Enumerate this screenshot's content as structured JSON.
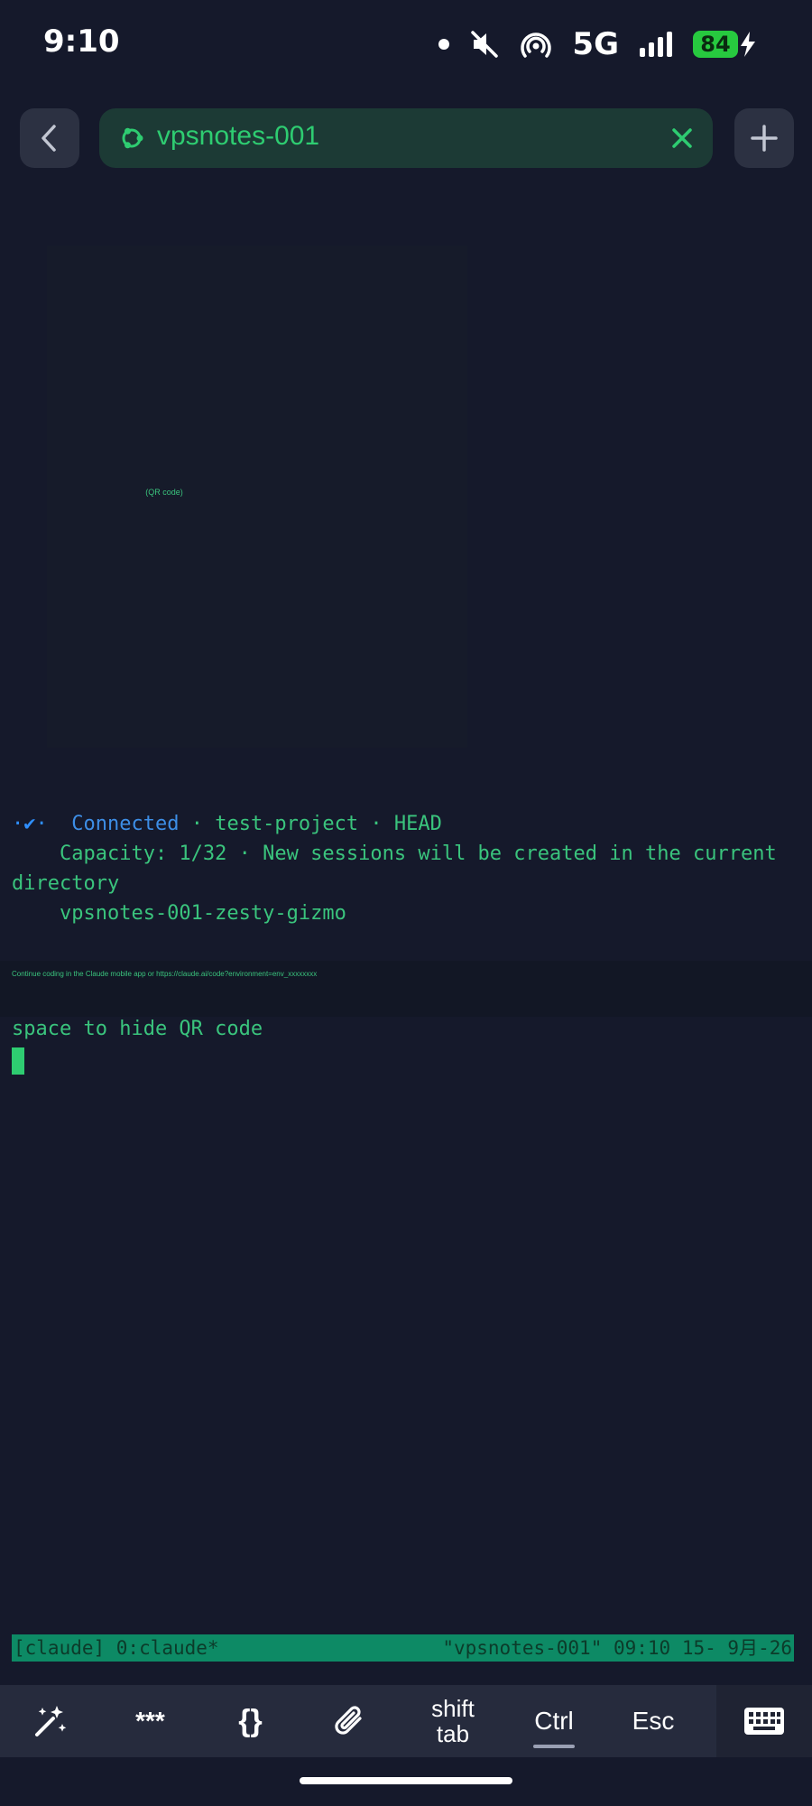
{
  "status_bar": {
    "time": "9:10",
    "network": "5G",
    "battery": "84",
    "icons": [
      "dot-icon",
      "mute-icon",
      "hotspot-icon",
      "signal-icon",
      "battery-icon",
      "charging-icon"
    ]
  },
  "nav": {
    "back_icon": "chevron-left-icon",
    "session_icon": "ubuntu-icon",
    "session_name": "vpsnotes-001",
    "close_icon": "close-icon",
    "add_icon": "plus-icon"
  },
  "qr": {
    "label": "(QR code)"
  },
  "terminal": {
    "spinner": "·✔·",
    "connected": "Connected",
    "status_rest": " · test-project · HEAD",
    "capacity_line1": "    Capacity: 1/32 · New sessions will be created in the current",
    "capacity_line2": "directory",
    "session_id": "    vpsnotes-001-zesty-gizmo",
    "url_line": "Continue coding in the Claude mobile app or https://claude.ai/code?environment=env_xxxxxxxx",
    "hint": "space to hide QR code"
  },
  "tmux": {
    "left": "[claude] 0:claude*",
    "right": "\"vpsnotes-001\" 09:10 15- 9月-26"
  },
  "keyboard_bar": {
    "magic_icon": "magic-wand-icon",
    "stars": "***",
    "braces": "{}",
    "attach_icon": "paperclip-icon",
    "shift": "shift",
    "tab": "tab",
    "ctrl": "Ctrl",
    "esc": "Esc",
    "keyboard_icon": "keyboard-icon"
  },
  "colors": {
    "background": "#15192b",
    "accent_green": "#2ecc71",
    "connected_blue": "#3d8ee6",
    "tmux_bar": "#0d8a65"
  }
}
